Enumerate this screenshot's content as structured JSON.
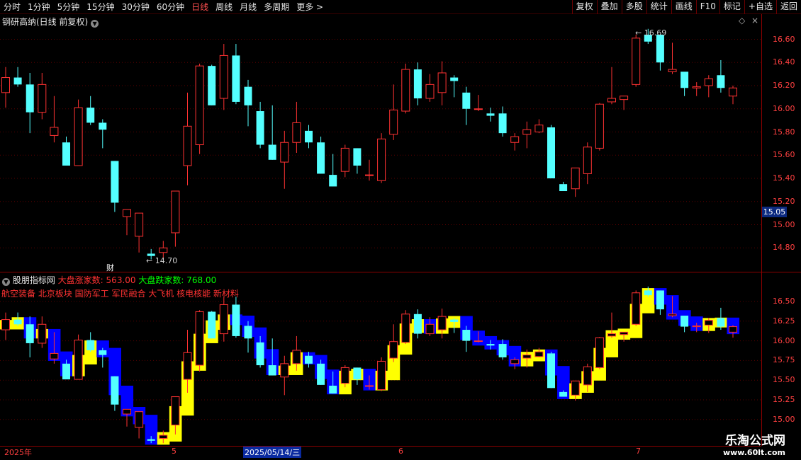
{
  "toolbar": {
    "periods": [
      "分时",
      "1分钟",
      "5分钟",
      "15分钟",
      "30分钟",
      "60分钟",
      "日线",
      "周线",
      "月线",
      "多周期",
      "更多 >"
    ],
    "active_period": "日线",
    "tools": [
      "复权",
      "叠加",
      "多股",
      "统计",
      "画线",
      "F10",
      "标记",
      "+自选",
      "返回"
    ]
  },
  "main_panel": {
    "title": "钢研高纳(日线 前复权)",
    "y_ticks": [
      "16.60",
      "16.40",
      "16.20",
      "16.00",
      "15.80",
      "15.60",
      "15.40",
      "15.20",
      "15.00",
      "14.80"
    ],
    "current_price": "15.05",
    "high_label": "16.69",
    "low_label": "14.70",
    "finance_marker": "财"
  },
  "indicator_panel": {
    "title": "股朋指标网",
    "up_label": "大盘涨家数:",
    "up_value": "563.00",
    "down_label": "大盘跌家数:",
    "down_value": "768.00",
    "sectors": "航空装备 北京板块 国防军工 军民融合 大飞机 核电核能 新材料",
    "y_ticks": [
      "16.50",
      "16.25",
      "16.00",
      "15.75",
      "15.50",
      "15.25",
      "15.00"
    ]
  },
  "x_axis": {
    "labels": [
      "2025年",
      "5",
      "6",
      "7"
    ],
    "cursor_date": "2025/05/14/三"
  },
  "watermark": {
    "line1": "乐淘公式网",
    "line2": "www.60lt.com"
  },
  "colors": {
    "up": "#ff3232",
    "down": "#54ffff",
    "yellow_band": "#ffff00",
    "blue_band": "#0000ff"
  },
  "candles": [
    [
      16.14,
      16.36,
      16.01,
      16.27
    ],
    [
      16.27,
      16.36,
      16.19,
      16.21
    ],
    [
      16.21,
      16.31,
      15.79,
      15.97
    ],
    [
      15.97,
      16.31,
      15.91,
      16.21
    ],
    [
      15.77,
      16.11,
      15.71,
      15.84
    ],
    [
      15.71,
      15.76,
      15.54,
      15.51
    ],
    [
      15.51,
      16.08,
      15.54,
      16.01
    ],
    [
      16.01,
      16.11,
      15.86,
      15.88
    ],
    [
      15.88,
      15.91,
      15.66,
      15.82
    ],
    [
      15.55,
      15.55,
      15.11,
      15.19
    ],
    [
      15.07,
      15.13,
      14.91,
      15.13
    ],
    [
      14.9,
      15.1,
      14.76,
      15.1
    ],
    [
      14.75,
      14.79,
      14.7,
      14.73
    ],
    [
      14.76,
      14.86,
      14.7,
      14.8
    ],
    [
      14.93,
      15.29,
      14.81,
      15.29
    ],
    [
      15.51,
      16.14,
      15.34,
      15.85
    ],
    [
      15.69,
      16.39,
      15.61,
      16.37
    ],
    [
      16.37,
      16.38,
      16.03,
      16.03
    ],
    [
      16.09,
      16.56,
      15.99,
      16.46
    ],
    [
      16.46,
      16.56,
      16.04,
      16.06
    ],
    [
      16.19,
      16.25,
      15.85,
      16.03
    ],
    [
      15.98,
      16.06,
      15.66,
      15.69
    ],
    [
      15.69,
      16.03,
      15.56,
      15.56
    ],
    [
      15.54,
      15.81,
      15.31,
      15.71
    ],
    [
      15.71,
      16.06,
      15.62,
      15.88
    ],
    [
      15.81,
      15.86,
      15.66,
      15.71
    ],
    [
      15.71,
      15.76,
      15.44,
      15.44
    ],
    [
      15.43,
      15.61,
      15.33,
      15.33
    ],
    [
      15.46,
      15.69,
      15.41,
      15.66
    ],
    [
      15.66,
      15.66,
      15.44,
      15.51
    ],
    [
      15.43,
      15.56,
      15.38,
      15.43
    ],
    [
      15.38,
      15.79,
      15.36,
      15.74
    ],
    [
      15.78,
      16.21,
      15.73,
      15.99
    ],
    [
      15.98,
      16.39,
      15.96,
      16.34
    ],
    [
      16.34,
      16.4,
      16.03,
      16.09
    ],
    [
      16.09,
      16.3,
      16.06,
      16.21
    ],
    [
      16.14,
      16.41,
      16.03,
      16.31
    ],
    [
      16.27,
      16.29,
      16.1,
      16.24
    ],
    [
      16.14,
      16.19,
      15.86,
      16.0
    ],
    [
      16.0,
      16.12,
      15.98,
      16.0
    ],
    [
      15.96,
      16.01,
      15.89,
      15.94
    ],
    [
      15.96,
      16.02,
      15.76,
      15.79
    ],
    [
      15.71,
      15.79,
      15.64,
      15.76
    ],
    [
      15.78,
      15.89,
      15.66,
      15.82
    ],
    [
      15.8,
      15.91,
      15.79,
      15.86
    ],
    [
      15.84,
      15.86,
      15.4,
      15.4
    ],
    [
      15.35,
      15.37,
      15.29,
      15.29
    ],
    [
      15.31,
      15.48,
      15.24,
      15.49
    ],
    [
      15.44,
      15.71,
      15.35,
      15.67
    ],
    [
      15.66,
      16.05,
      15.64,
      16.04
    ],
    [
      16.06,
      16.36,
      16.04,
      16.09
    ],
    [
      16.08,
      16.11,
      15.99,
      16.11
    ],
    [
      16.21,
      16.64,
      16.19,
      16.61
    ],
    [
      16.64,
      16.69,
      16.56,
      16.58
    ],
    [
      16.64,
      16.64,
      16.33,
      16.4
    ],
    [
      16.32,
      16.57,
      16.3,
      16.34
    ],
    [
      16.32,
      16.31,
      16.11,
      16.18
    ],
    [
      16.18,
      16.23,
      16.11,
      16.19
    ],
    [
      16.2,
      16.29,
      16.1,
      16.26
    ],
    [
      16.29,
      16.42,
      16.14,
      16.18
    ],
    [
      16.11,
      16.2,
      16.04,
      16.18
    ]
  ]
}
